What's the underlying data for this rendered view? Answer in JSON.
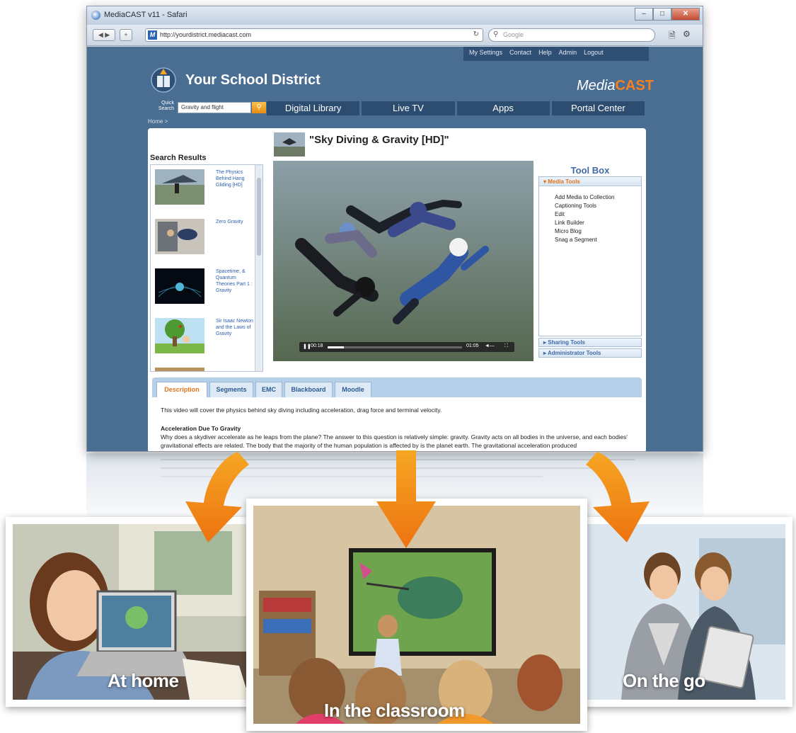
{
  "browser": {
    "window_title": "MediaCAST v11 - Safari",
    "url": "http://yourdistrict.mediacast.com",
    "search_placeholder": "Google"
  },
  "page": {
    "top_links": [
      "My Settings",
      "Contact",
      "Help",
      "Admin",
      "Logout"
    ],
    "school_name": "Your School District",
    "brand": {
      "part1": "Media",
      "part2": "CAST"
    },
    "quick_search_label": "Quick Search",
    "quick_search_value": "Gravity and flight",
    "main_nav": [
      "Digital Library",
      "Live TV",
      "Apps",
      "Portal Center"
    ],
    "breadcrumb": "Home >",
    "search_results": {
      "title": "Search Results",
      "items": [
        {
          "label": "The Physics Behind Hang Gliding [HD]"
        },
        {
          "label": "Zero Gravity"
        },
        {
          "label": "Spacetime, & Quantum Theories Part 1 : Gravity"
        },
        {
          "label": "Sir Isaac Newton and the Laws of Gravity"
        }
      ]
    },
    "video": {
      "title": "\"Sky Diving & Gravity [HD]\"",
      "time_current": "00:18",
      "time_total": "01:05",
      "progress": 0.12
    },
    "toolbox": {
      "title": "Tool Box",
      "media_tools_label": "Media Tools",
      "media_tools": [
        "Add Media to Collection",
        "Captioning Tools",
        "Edit",
        "Link Builder",
        "Micro Blog",
        "Snag a Segment"
      ],
      "sharing_label": "Sharing Tools",
      "admin_label": "Administrator Tools"
    },
    "tabs": [
      "Description",
      "Segments",
      "EMC",
      "Blackboard",
      "Moodle"
    ],
    "description": {
      "lead": "This video will cover the physics behind sky diving including acceleration, drag force and terminal velocity.",
      "heading": "Acceleration Due To Gravity",
      "body": "Why does a skydiver accelerate as he leaps from the plane? The answer to this question is relatively simple: gravity. Gravity acts on all bodies in the universe, and each bodies' gravitational effects are related. The body that the majority of the human population is affected by is the planet earth. The gravitational acceleration produced"
    }
  },
  "photos": {
    "home": "At home",
    "classroom": "In the classroom",
    "go": "On the go"
  },
  "colors": {
    "page_blue": "#4a6d92",
    "nav_dark": "#2c4c70",
    "accent_orange": "#f58220",
    "link_blue": "#2a5eb0"
  }
}
